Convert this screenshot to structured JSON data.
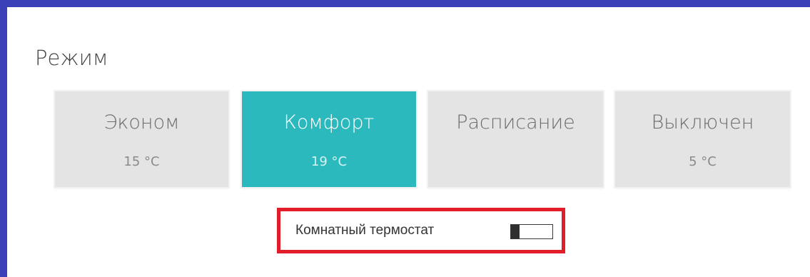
{
  "panel": {
    "title": "Режим"
  },
  "modes": [
    {
      "name": "Эконом",
      "temp": "15 °C",
      "active": false
    },
    {
      "name": "Комфорт",
      "temp": "19 °C",
      "active": true
    },
    {
      "name": "Расписание",
      "temp": "",
      "active": false
    },
    {
      "name": "Выключен",
      "temp": "5 °C",
      "active": false
    }
  ],
  "thermostat": {
    "label": "Комнатный термостат",
    "enabled": false
  },
  "colors": {
    "frame": "#3b3fb8",
    "active_mode": "#2bb9bd",
    "inactive_mode": "#e4e4e4",
    "highlight_border": "#e11d2a"
  }
}
